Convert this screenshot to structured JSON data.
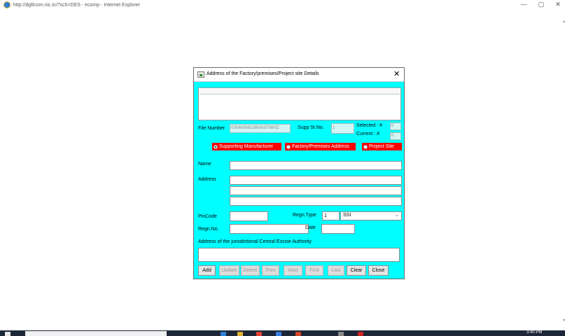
{
  "window": {
    "title": "http://dgftcom.nic.in/?sch=DES - ecomp - Internet Explorer",
    "minimize_glyph": "—",
    "maximize_glyph": "▢",
    "close_glyph": "✕"
  },
  "dialog": {
    "title": "Address of the Factory/premises/Project site Details",
    "close_glyph": "✕",
    "file_number_label": "File Number",
    "file_number_value": "03/06/056/20800/0708/02",
    "supp_srno_label": "Supp Sr.No.",
    "supp_srno_value": "1",
    "selected_label": "Selected : #",
    "selected_value": "0",
    "current_label": "Current : #",
    "current_value": "0",
    "radios": [
      {
        "label": "Supporting Manufacturer",
        "checked": true
      },
      {
        "label": "Factory/Premises Address",
        "checked": false
      },
      {
        "label": "Project Site",
        "checked": false
      }
    ],
    "name_label": "Name",
    "address_label": "Address",
    "pincode_label": "PinCode",
    "regn_type_label": "Regn.Type",
    "regn_type_code": "1",
    "regn_type_select": "SSI",
    "regn_no_label": "Regn.No.",
    "date_label": "Date",
    "excise_label": "Address of the jurisdictional Central Excise Authority",
    "buttons": {
      "add": "Add",
      "update": "Update",
      "delete": "Delete",
      "prev": "Prev",
      "next": "Next",
      "first": "First",
      "last": "Last",
      "clear": "Clear",
      "close": "Close"
    }
  },
  "scrollbar": {
    "up_glyph": "▲",
    "down_glyph": "▼"
  },
  "taskbar": {
    "time": "3:40 PM",
    "icons": [
      {
        "name": "windows-icon",
        "color": "#e8e8e8"
      },
      {
        "name": "ie-taskbar-icon",
        "color": "#2f7fd6"
      },
      {
        "name": "folder-taskbar-icon",
        "color": "#e0b030"
      },
      {
        "name": "chrome-taskbar-icon",
        "color": "#e34133"
      },
      {
        "name": "mail-taskbar-icon",
        "color": "#3a7de0"
      },
      {
        "name": "office-taskbar-icon",
        "color": "#d24726"
      },
      {
        "name": "app-taskbar-icon",
        "color": "#888888"
      },
      {
        "name": "pdf-taskbar-icon",
        "color": "#cc2222"
      }
    ]
  }
}
